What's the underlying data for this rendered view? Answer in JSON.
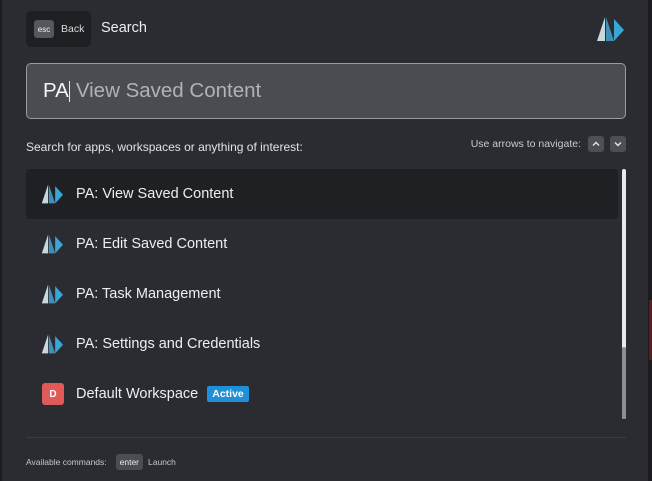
{
  "header": {
    "esc_key": "esc",
    "back_label": "Back",
    "title": "Search"
  },
  "search": {
    "typed": "PA",
    "suggestion": "View Saved Content"
  },
  "hint": {
    "text": "Search for apps, workspaces or anything of interest:",
    "nav_label": "Use arrows to navigate:"
  },
  "results": [
    {
      "label": "PA: View Saved Content",
      "icon": "app-logo-icon",
      "selected": true
    },
    {
      "label": "PA: Edit Saved Content",
      "icon": "app-logo-icon",
      "selected": false
    },
    {
      "label": "PA: Task Management",
      "icon": "app-logo-icon",
      "selected": false
    },
    {
      "label": "PA: Settings and Credentials",
      "icon": "app-logo-icon",
      "selected": false
    },
    {
      "label": "Default Workspace",
      "icon": "workspace-badge",
      "badge_letter": "D",
      "status": "Active",
      "selected": false
    }
  ],
  "footer": {
    "label": "Available commands:",
    "key": "enter",
    "action": "Launch"
  },
  "colors": {
    "background": "#2b2c31",
    "selected_row": "#1f2024",
    "logo_dark": "#3f8fb7",
    "logo_light": "#9fd6ea",
    "workspace_badge": "#e05a5a",
    "active_badge": "#1f8fd8"
  }
}
